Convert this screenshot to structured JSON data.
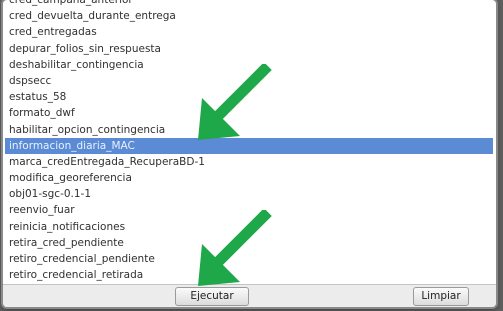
{
  "list": {
    "items": [
      "cred_campana_anterior",
      "cred_devuelta_durante_entrega",
      "cred_entregadas",
      "depurar_folios_sin_respuesta",
      "deshabilitar_contingencia",
      "dspsecc",
      "estatus_58",
      "formato_dwf",
      "habilitar_opcion_contingencia",
      "informacion_diaria_MAC",
      "marca_credEntregada_RecuperaBD-1",
      "modifica_georeferencia",
      "obj01-sgc-0.1-1",
      "reenvio_fuar",
      "reinicia_notificaciones",
      "retira_cred_pendiente",
      "retiro_credencial_pendiente",
      "retiro_credencial_retirada"
    ],
    "selected_index": 9
  },
  "buttons": {
    "execute": "Ejecutar",
    "clear": "Limpiar"
  },
  "colors": {
    "selection": "#5b8bd5",
    "arrow": "#1fa84a"
  },
  "annotations": [
    "arrow-icon",
    "arrow-icon"
  ]
}
